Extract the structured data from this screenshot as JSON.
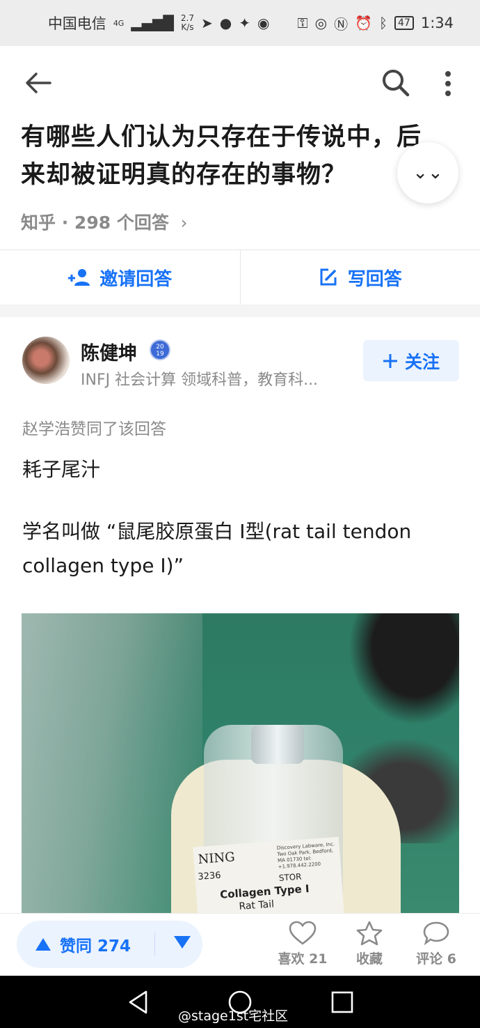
{
  "status_bar": {
    "carrier": "中国电信",
    "network": "4G",
    "speed_value": "2.7",
    "speed_unit": "K/s",
    "battery": "47",
    "time": "1:34",
    "icons": [
      "signal-icon",
      "send-icon",
      "qq-icon",
      "twitter-icon",
      "wechat-icon",
      "key-icon",
      "eye-icon",
      "nfc-icon",
      "alarm-icon",
      "bluetooth-icon",
      "battery-icon"
    ]
  },
  "question": {
    "title_line1": "有哪些人们认为只存在于传说中，后",
    "title_line2": "来却被证明真的存在的事物？",
    "source": "知乎",
    "answer_count": "· 298 个回答",
    "chevron": "›"
  },
  "actions": {
    "invite_label": "邀请回答",
    "write_label": "写回答"
  },
  "answer": {
    "author": "陈健坤",
    "badge_line1": "20",
    "badge_line2": "19",
    "bio": "INFJ 社会计算 领域科普，教育科...",
    "follow_label": "关注",
    "liked_by": "赵学浩赞同了该回答",
    "paragraph1": "耗子尾汁",
    "paragraph2": "学名叫做 “鼠尾胶原蛋白 I型(rat tail tendon collagen type I)”",
    "image_label": {
      "brand": "NING",
      "address": "Discovery Labware, Inc. Two Oak Park, Bedford, MA 01730 tel: +1.978.442.2200",
      "catalog": "3236",
      "storage": "STOR",
      "product": "Collagen Type I",
      "subtitle": "Rat Tail"
    }
  },
  "bottom_bar": {
    "upvote_label": "赞同 274",
    "like_label": "喜欢 21",
    "favorite_label": "收藏",
    "comment_label": "评论 6"
  },
  "watermark": "@stage1st宅社区",
  "colors": {
    "accent": "#1772f6",
    "accent_bg": "#ebf3fe",
    "muted_text": "#8a8a8a",
    "status_bar_bg": "#ededed"
  }
}
